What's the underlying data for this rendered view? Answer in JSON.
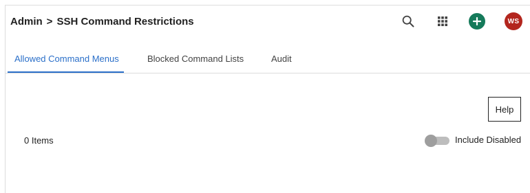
{
  "header": {
    "breadcrumb_parent": "Admin",
    "breadcrumb_separator": ">",
    "breadcrumb_current": "SSH Command Restrictions",
    "avatar_initials": "WS",
    "icons": [
      "search-icon",
      "apps-grid-icon",
      "add-icon"
    ]
  },
  "tabs": [
    {
      "label": "Allowed Command Menus",
      "active": true
    },
    {
      "label": "Blocked Command Lists",
      "active": false
    },
    {
      "label": "Audit",
      "active": false
    }
  ],
  "content": {
    "help_label": "Help",
    "items_count": "0 Items",
    "include_disabled_label": "Include Disabled",
    "include_disabled_on": false
  },
  "colors": {
    "accent": "#2a6fc9",
    "add_button": "#157a5a",
    "avatar": "#b3261e"
  }
}
